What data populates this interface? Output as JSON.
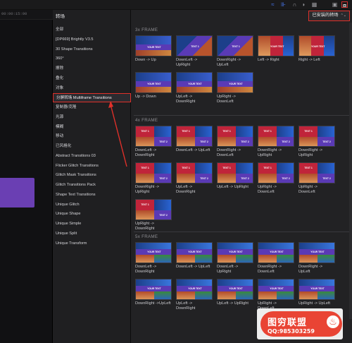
{
  "toolbar": {
    "timecode": "00:00:15:00"
  },
  "sidebar": {
    "title": "转场",
    "items": [
      "全部",
      "[DP669] Brightly V3.5",
      "30 Shape Transitions",
      "360°",
      "擦除",
      "叠化",
      "对象",
      "分屏转场 Multiframe Transitions",
      "复制器/克隆",
      "光源",
      "模糊",
      "移动",
      "已风格化",
      "Abstract Transitions 03",
      "Flicker Glitch Transitions",
      "Glitch Mask Transitions",
      "Glitch Transitions Pack",
      "Shape Text Transitions",
      "Unique Glitch",
      "Unique Shape",
      "Unique Simple",
      "Unique Split",
      "Unique Transform"
    ],
    "selected_index": 7
  },
  "filter": {
    "label": "已安装的转场"
  },
  "sections": [
    {
      "title": "3x FRAME",
      "tiles": [
        "Down -> Up",
        "DownLeft -> UpRight",
        "DownRight -> UpLeft",
        "Left -> Right",
        "Right -> Left",
        "Up -> Down",
        "UpLeft -> DownRight",
        "UpRight -> DownLeft"
      ]
    },
    {
      "title": "4x FRAME",
      "tiles": [
        "DownLeft -> DownRight",
        "DownLeft -> UpLeft",
        "DownRight -> DownLeft",
        "DownRight -> UpRight",
        "DownRight -> UpRight",
        "DownRight -> UpRight",
        "UpLeft -> DownRight",
        "UpLeft -> UpRight",
        "UpRight -> DownLeft",
        "UpRight -> DownLeft",
        "UpRight -> DownRight"
      ]
    },
    {
      "title": "5x FRAME",
      "tiles": [
        "DownLeft -> DownRight",
        "DownLeft -> UpLeft",
        "DownLeft -> UpRight",
        "DownRight -> DownLeft",
        "DownRight -> UpLeft",
        "DownRight ->UpLeft",
        "UpLeft -> DownRight",
        "UpLeft -> UpRight",
        "UpRight -> DownLeft",
        "UpRight -> UpLeft"
      ]
    }
  ],
  "thumb_text": {
    "main": "YOUR TEXT",
    "t1": "TEXT 1",
    "t2": "TEXT 2",
    "t3": "TEXT 3"
  },
  "watermark": {
    "title": "图穷联盟",
    "qq": "QQ:985303259"
  },
  "colors": {
    "accent_red": "#e0302a",
    "clip_purple": "#6a3fb3",
    "thumb_blue": "#1c3f8a",
    "thumb_red": "#c0243a",
    "thumb_purple": "#5a3ab5"
  },
  "icons": [
    "waveform-icon",
    "headphones-icon",
    "snapping-icon",
    "audio-icon",
    "effects-browser-icon",
    "transitions-browser-icon"
  ]
}
